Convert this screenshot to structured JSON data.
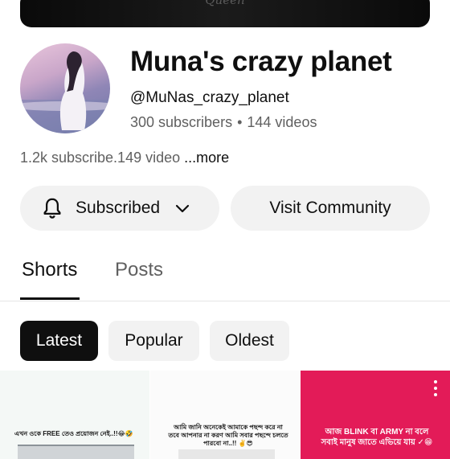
{
  "banner": {
    "text": "Queen"
  },
  "channel": {
    "name": "Muna's crazy planet",
    "handle": "@MuNas_crazy_planet",
    "subscribers": "300 subscribers",
    "separator": "•",
    "videos": "144 videos",
    "description": "1.2k subscribe.149 video",
    "more_label": "...more"
  },
  "actions": {
    "subscribed_label": "Subscribed",
    "community_label": "Visit Community"
  },
  "tabs": [
    {
      "label": "Shorts",
      "selected": true
    },
    {
      "label": "Posts",
      "selected": false
    }
  ],
  "chips": [
    {
      "label": "Latest",
      "selected": true
    },
    {
      "label": "Popular",
      "selected": false
    },
    {
      "label": "Oldest",
      "selected": false
    }
  ],
  "shorts": [
    {
      "caption": "এখন ওকে FREE তেও প্রয়োজন নেই..!!😂🤣"
    },
    {
      "caption": "আমি জানি অনেকেই আমাকে পছন্দ করে না তবে আপনার না করণ আমি সবার পছন্দে চলতে পারবো না..!! ✌️😎"
    },
    {
      "caption": "আজ BLINK বা ARMY না বলে সবাই মানুষ জাতে এভিয়ে যায় ✓😁"
    }
  ],
  "colors": {
    "accent": "#0f0f0f",
    "chip_bg": "#f2f2f2",
    "secondary_text": "#606060",
    "short3_bg": "#e31b58"
  },
  "icons": [
    "bell-icon",
    "chevron-down-icon",
    "more-vert-icon"
  ]
}
